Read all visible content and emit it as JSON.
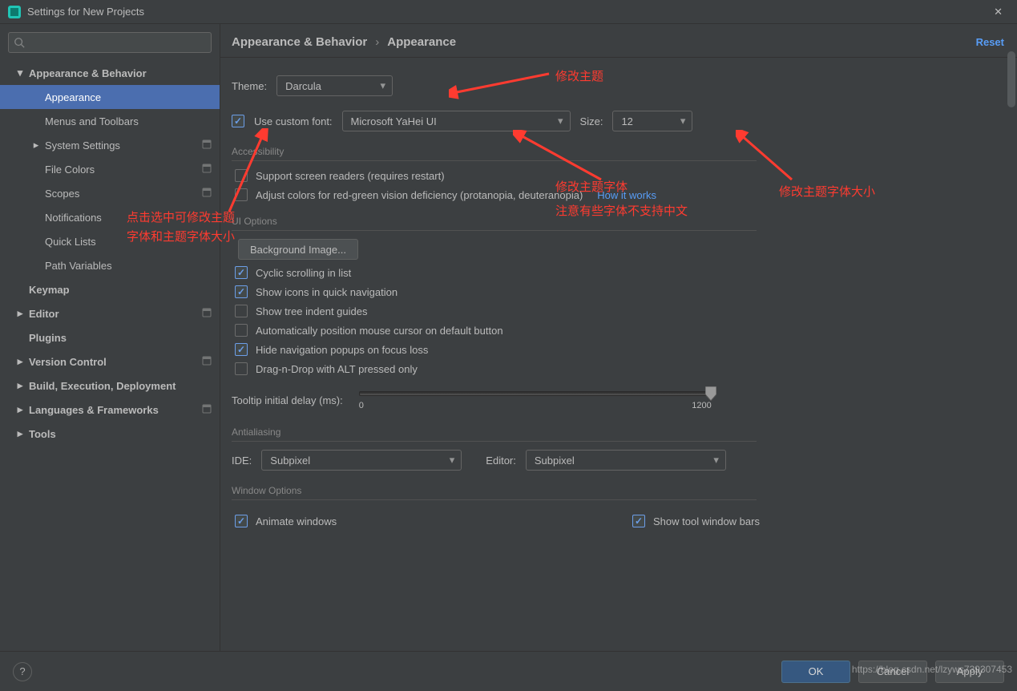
{
  "window": {
    "title": "Settings for New Projects"
  },
  "sidebar": {
    "items": [
      {
        "label": "Appearance & Behavior",
        "level": 1,
        "arrow": "down",
        "bold": true
      },
      {
        "label": "Appearance",
        "level": 2,
        "selected": true
      },
      {
        "label": "Menus and Toolbars",
        "level": 2
      },
      {
        "label": "System Settings",
        "level": 2,
        "arrow": "right",
        "hasMod": true
      },
      {
        "label": "File Colors",
        "level": 2,
        "hasMod": true
      },
      {
        "label": "Scopes",
        "level": 2,
        "hasMod": true
      },
      {
        "label": "Notifications",
        "level": 2
      },
      {
        "label": "Quick Lists",
        "level": 2
      },
      {
        "label": "Path Variables",
        "level": 2
      },
      {
        "label": "Keymap",
        "level": 1,
        "bold": true
      },
      {
        "label": "Editor",
        "level": 1,
        "arrow": "right",
        "bold": true,
        "hasMod": true
      },
      {
        "label": "Plugins",
        "level": 1,
        "bold": true
      },
      {
        "label": "Version Control",
        "level": 1,
        "arrow": "right",
        "bold": true,
        "hasMod": true
      },
      {
        "label": "Build, Execution, Deployment",
        "level": 1,
        "arrow": "right",
        "bold": true
      },
      {
        "label": "Languages & Frameworks",
        "level": 1,
        "arrow": "right",
        "bold": true,
        "hasMod": true
      },
      {
        "label": "Tools",
        "level": 1,
        "arrow": "right",
        "bold": true
      }
    ]
  },
  "breadcrumb": {
    "l1": "Appearance & Behavior",
    "l2": "Appearance",
    "reset": "Reset"
  },
  "theme": {
    "label": "Theme:",
    "value": "Darcula"
  },
  "customFont": {
    "checked": true,
    "label": "Use custom font:",
    "font": "Microsoft YaHei UI",
    "sizeLabel": "Size:",
    "size": "12"
  },
  "sections": {
    "accessibility": {
      "title": "Accessibility",
      "screenReaders": {
        "checked": false,
        "label": "Support screen readers (requires restart)"
      },
      "colorDef": {
        "checked": false,
        "label": "Adjust colors for red-green vision deficiency (protanopia, deuteranopia)",
        "link": "How it works"
      }
    },
    "uiOptions": {
      "title": "UI Options",
      "bgImage": "Background Image...",
      "checks": [
        {
          "checked": true,
          "label": "Cyclic scrolling in list"
        },
        {
          "checked": true,
          "label": "Show icons in quick navigation"
        },
        {
          "checked": false,
          "label": "Show tree indent guides"
        },
        {
          "checked": false,
          "label": "Automatically position mouse cursor on default button"
        },
        {
          "checked": true,
          "label": "Hide navigation popups on focus loss"
        },
        {
          "checked": false,
          "label": "Drag-n-Drop with ALT pressed only"
        }
      ],
      "tooltip": {
        "label": "Tooltip initial delay (ms):",
        "min": "0",
        "max": "1200"
      }
    },
    "antialiasing": {
      "title": "Antialiasing",
      "ideLabel": "IDE:",
      "ideValue": "Subpixel",
      "editorLabel": "Editor:",
      "editorValue": "Subpixel"
    },
    "windowOptions": {
      "title": "Window Options",
      "animate": {
        "checked": true,
        "label": "Animate windows"
      },
      "toolbars": {
        "checked": true,
        "label": "Show tool window bars"
      }
    }
  },
  "footer": {
    "ok": "OK",
    "cancel": "Cancel",
    "apply": "Apply"
  },
  "annotations": {
    "a1": "修改主题",
    "a2": "修改主题字体",
    "a2b": "注意有些字体不支持中文",
    "a3": "修改主题字体大小",
    "a4": "点击选中可修改主题",
    "a4b": "字体和主题字体大小"
  },
  "watermark": "https://blog.csdn.net/lzyws739307453"
}
